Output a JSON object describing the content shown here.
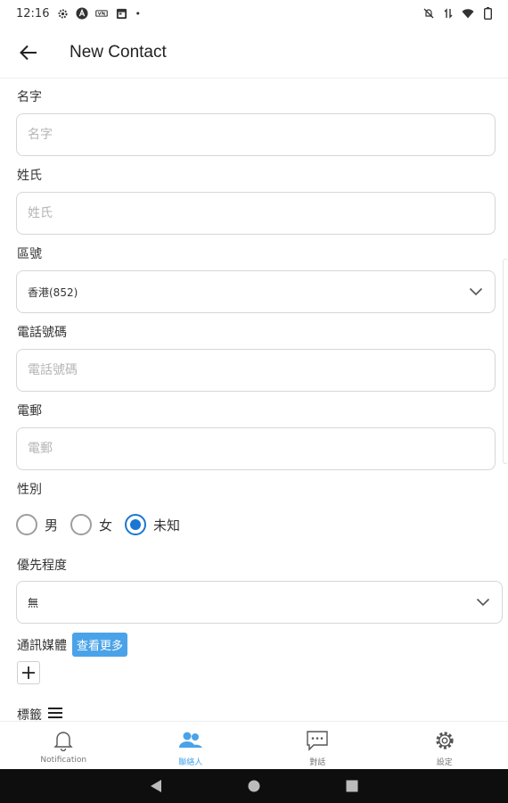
{
  "status_bar": {
    "time": "12:16",
    "dot": "•",
    "left_icons": [
      "settings-gear-icon",
      "a-circle-icon",
      "vpn-icon",
      "calendar-icon"
    ],
    "right_icons": [
      "mute-icon",
      "data-arrows-icon",
      "wifi-icon",
      "battery-icon"
    ]
  },
  "app_bar": {
    "title": "New Contact",
    "back_icon": "arrow-left-icon"
  },
  "form": {
    "first_name": {
      "label": "名字",
      "placeholder": "名字",
      "value": ""
    },
    "last_name": {
      "label": "姓氏",
      "placeholder": "姓氏",
      "value": ""
    },
    "area_code": {
      "label": "區號",
      "selected": "香港(852)"
    },
    "phone": {
      "label": "電話號碼",
      "placeholder": "電話號碼",
      "value": ""
    },
    "email": {
      "label": "電郵",
      "placeholder": "電郵",
      "value": ""
    },
    "gender": {
      "label": "性別",
      "options": [
        {
          "label": "男",
          "checked": false
        },
        {
          "label": "女",
          "checked": false
        },
        {
          "label": "未知",
          "checked": true
        }
      ]
    },
    "priority": {
      "label": "優先程度",
      "selected": "無"
    },
    "media": {
      "label": "通訊媒體",
      "see_more": "查看更多",
      "add_symbol": "+"
    },
    "tags": {
      "label": "標籤"
    }
  },
  "bottom_nav": [
    {
      "label": "Notification",
      "icon": "bell-icon",
      "active": false
    },
    {
      "label": "聯絡人",
      "icon": "contacts-icon",
      "active": true
    },
    {
      "label": "對話",
      "icon": "chat-icon",
      "active": false
    },
    {
      "label": "設定",
      "icon": "settings-icon",
      "active": false
    }
  ],
  "colors": {
    "accent": "#4aa3e8",
    "radio_selected": "#1976d2",
    "system_nav_bg": "#0e0e0e"
  }
}
